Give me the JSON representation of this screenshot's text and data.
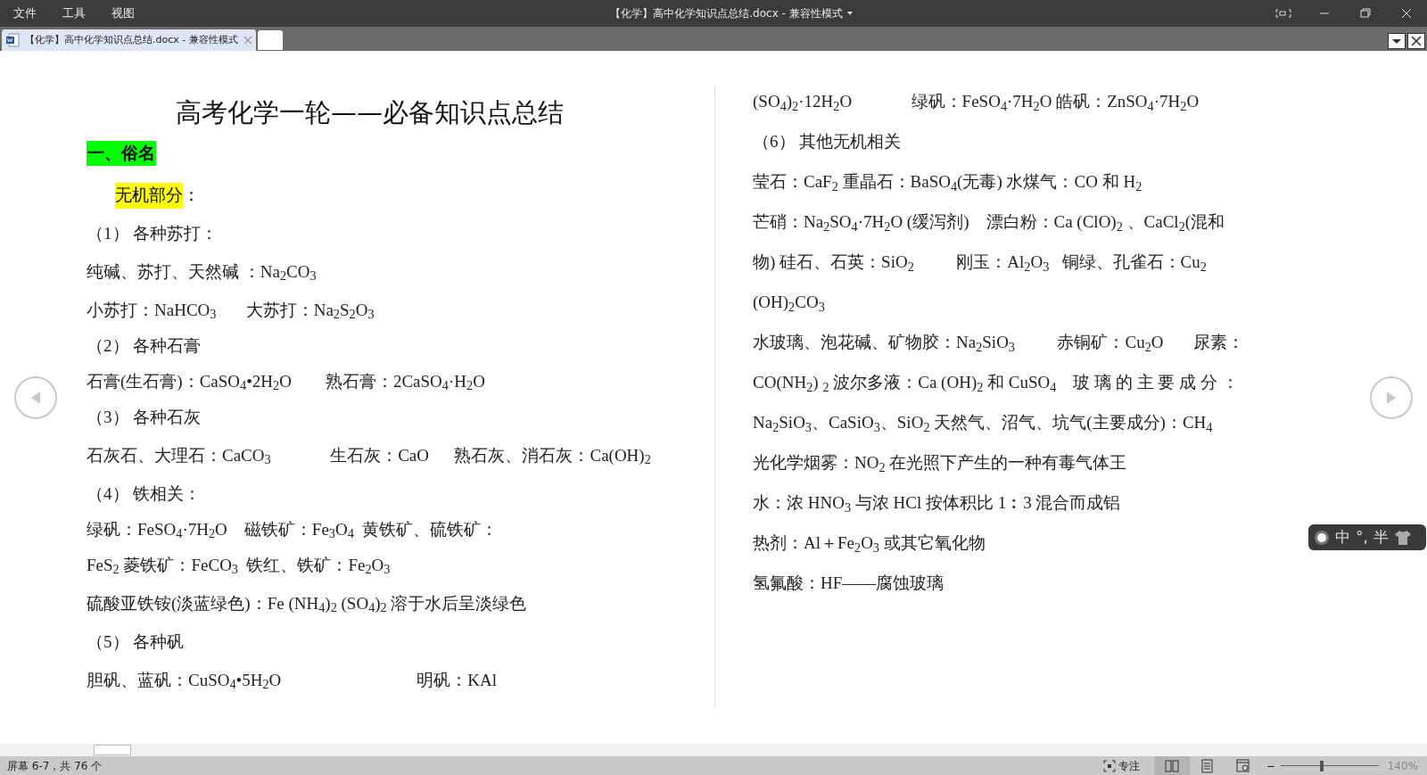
{
  "menu": [
    "文件",
    "工具",
    "视图"
  ],
  "window": {
    "title": "【化学】高中化学知识点总结.docx - 兼容性模式"
  },
  "tabs": [
    {
      "label": "【化学】高中化学知识点总结.docx - 兼容性模式",
      "selected": true
    }
  ],
  "document": {
    "title": "高考化学一轮——必备知识点总结",
    "section": "一、俗名",
    "subsection": "无机部分",
    "subsection_suffix": "：",
    "left_lines": [
      "（1） 各种苏打：",
      "纯碱、苏打、天然碱 ：Na$_{2}$CO$_{3}$",
      "小苏打：NaHCO$_{3}$       大苏打：Na$_{2}$S$_{2}$O$_{3}$",
      "（2） 各种石膏",
      "石膏(生石膏)：CaSO$_{4}$•2H$_{2}$O        熟石膏：2CaSO$_{4}$·H$_{2}$O",
      "（3） 各种石灰",
      "石灰石、大理石：CaCO$_{3}$              生石灰：CaO      熟石灰、消石灰：Ca(OH)$_{2}$",
      "（4） 铁相关：",
      "绿矾：FeSO$_{4}$·7H$_{2}$O    磁铁矿：Fe$_{3}$O$_{4}$  黄铁矿、硫铁矿：",
      "FeS$_{2}$ 菱铁矿：FeCO$_{3}$  铁红、铁矿：Fe$_{2}$O$_{3}$",
      "硫酸亚铁铵(淡蓝绿色)：Fe (NH$_{4}$)$_{2}$ (SO$_{4}$)$_{2}$ 溶于水后呈淡绿色",
      "（5） 各种矾",
      "胆矾、蓝矾：CuSO$_{4}$•5H$_{2}$O                                明矾：KAl"
    ],
    "right_lines": [
      "(SO$_{4}$)$_{2}$·12H$_{2}$O              绿矾：FeSO$_{4}$·7H$_{2}$O 皓矾：ZnSO$_{4}$·7H$_{2}$O",
      "（6） 其他无机相关",
      "莹石：CaF$_{2}$ 重晶石：BaSO$_{4}$(无毒) 水煤气：CO 和 H$_{2}$",
      "芒硝：Na$_{2}$SO$_{4}$·7H$_{2}$O (缓泻剂)    漂白粉：Ca (ClO)$_{2}$ 、CaCl$_{2}$(混和",
      "物) 硅石、石英：SiO$_{2}$          刚玉：Al$_{2}$O$_{3}$   铜绿、孔雀石：Cu$_{2}$",
      "(OH)$_{2}$CO$_{3}$",
      "水玻璃、泡花碱、矿物胶：Na$_{2}$SiO$_{3}$          赤铜矿：Cu$_{2}$O       尿素：",
      "CO(NH$_{2}$) $_{2}$ 波尔多液：Ca (OH)$_{2}$ 和 CuSO$_{4}$    玻 璃 的 主 要 成 分 ：",
      "Na$_{2}$SiO$_{3}$、CaSiO$_{3}$、SiO$_{2}$ 天然气、沼气、坑气(主要成分)：CH$_{4}$",
      "光化学烟雾：NO$_{2}$ 在光照下产生的一种有毒气体王",
      "水：浓 HNO$_{3}$ 与浓 HCl 按体积比 1︰3 混合而成铝",
      "热剂：Al＋Fe$_{2}$O$_{3}$ 或其它氧化物",
      "氢氟酸：HF——腐蚀玻璃"
    ]
  },
  "ime": {
    "mode": "中",
    "punct": "°,",
    "width": "半"
  },
  "status_bar": {
    "page": "屏幕 6-7，共 76 个",
    "focus": "专注",
    "zoom_out": "−",
    "zoom": "140%",
    "zoom_slider": {
      "level": 0.42
    }
  }
}
